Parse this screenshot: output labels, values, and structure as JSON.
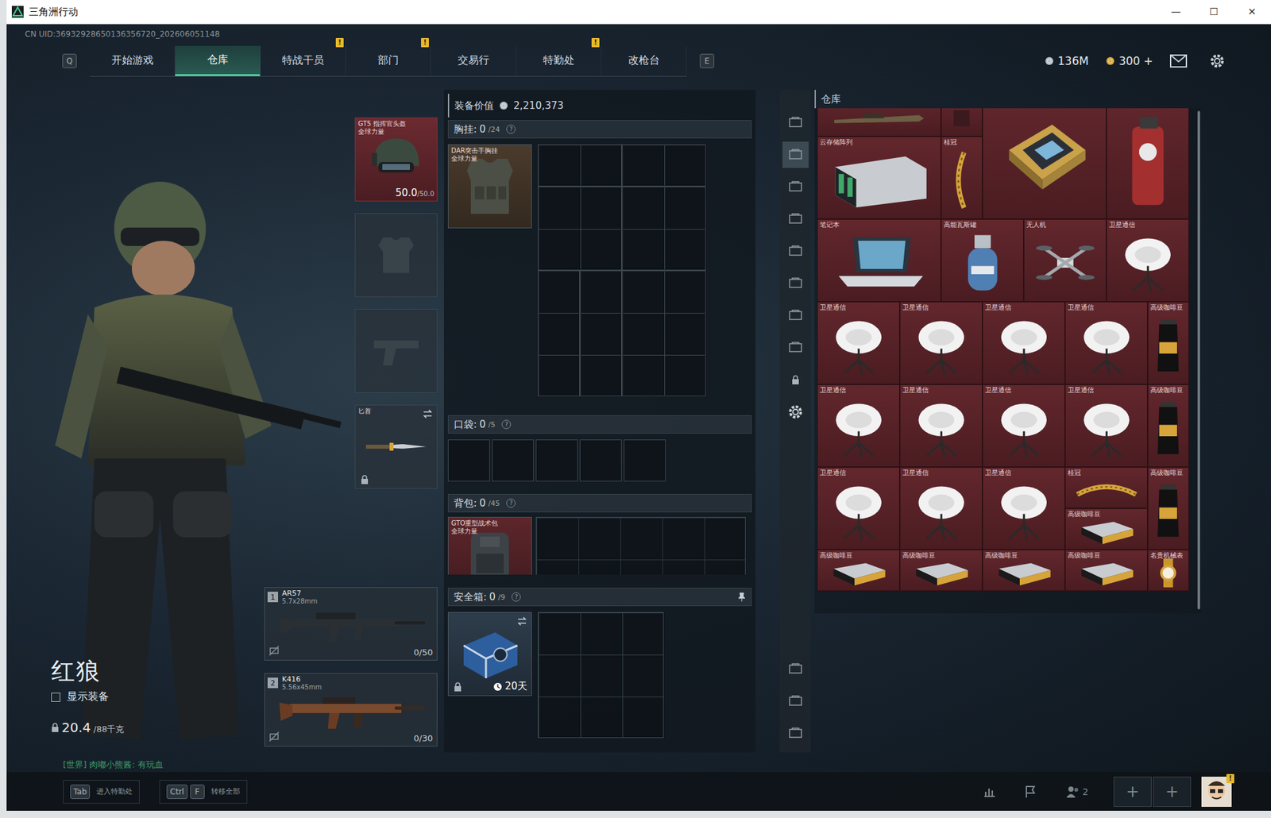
{
  "window": {
    "title": "三角洲行动",
    "buttons": [
      "—",
      "☐",
      "✕"
    ]
  },
  "uid": "CN UID:36932928650136356720_202606051148",
  "nav": {
    "left_key": "Q",
    "right_key": "E",
    "tabs": [
      {
        "label": "开始游戏",
        "selected": false,
        "alert": false,
        "badge": "!"
      },
      {
        "label": "仓库",
        "selected": true,
        "alert": false,
        "badge": "!"
      },
      {
        "label": "特战干员",
        "selected": false,
        "alert": true,
        "badge": "!"
      },
      {
        "label": "部门",
        "selected": false,
        "alert": true,
        "badge": "!"
      },
      {
        "label": "交易行",
        "selected": false,
        "alert": false,
        "badge": "!"
      },
      {
        "label": "特勤处",
        "selected": false,
        "alert": true,
        "badge": "!"
      },
      {
        "label": "改枪台",
        "selected": false,
        "alert": false,
        "badge": "!"
      }
    ]
  },
  "currency": [
    {
      "value": "136M",
      "color": "#b8c0c6"
    },
    {
      "value": "300 +",
      "color": "#d9a93a"
    }
  ],
  "operator": {
    "name": "红狼",
    "show_equipment": {
      "label": "显示装备",
      "checked": false
    },
    "weight": "20.4",
    "weight_max": "/88千克"
  },
  "chat": "[世界] 肉嘟小熊酱: 有玩血",
  "slots": {
    "helmet": {
      "name": "GT5 指挥官头盔",
      "sub": "全球力量",
      "durability": "50.0",
      "durability_max": "/50.0",
      "filled": true
    },
    "armor": {
      "filled": false
    },
    "pistol": {
      "filled": false
    },
    "melee": {
      "label": "匕首",
      "locked": true
    }
  },
  "weapons": [
    {
      "index": "1",
      "name": "AR57",
      "caliber": "5.7x28mm",
      "ammo": "0/50"
    },
    {
      "index": "2",
      "name": "K416",
      "caliber": "5.56x45mm",
      "ammo": "0/30"
    }
  ],
  "loadout": {
    "value_label": "装备价值",
    "value": "2,210,373",
    "chest": {
      "label": "胸挂:",
      "count": "0",
      "cap": "/24",
      "help": "?",
      "item": "DAR突击手胸挂",
      "item_sub": "全球力量"
    },
    "pockets": {
      "label": "口袋:",
      "count": "0",
      "cap": "/5",
      "help": "?"
    },
    "backpack": {
      "label": "背包:",
      "count": "0",
      "cap": "/45",
      "help": "?",
      "item": "GTO重型战术包",
      "item_sub": "全球力量"
    },
    "safebox": {
      "label": "安全箱:",
      "count": "0",
      "cap": "/9",
      "help": "?",
      "timer": "20天",
      "locked": true
    }
  },
  "sidebar": [
    {
      "selected": false
    },
    {
      "selected": true
    },
    {
      "selected": false
    },
    {
      "selected": false
    },
    {
      "selected": false
    },
    {
      "selected": false
    },
    {
      "selected": false
    },
    {
      "selected": false
    }
  ],
  "warehouse": {
    "title": "仓库",
    "items": [
      {
        "kind": "rifle"
      },
      {
        "kind": "misc"
      },
      {
        "kind": "cpu"
      },
      {
        "kind": "extinguisher"
      },
      {
        "kind": "server",
        "name": "云存储阵列"
      },
      {
        "kind": "crown-v",
        "name": "桂冠"
      },
      {
        "kind": "laptop",
        "name": "笔记本"
      },
      {
        "kind": "gas",
        "name": "高能瓦斯罐"
      },
      {
        "kind": "drone",
        "name": "无人机"
      },
      {
        "kind": "sat",
        "name": "卫星通信"
      },
      {
        "kind": "sat",
        "name": "卫星通信"
      },
      {
        "kind": "sat",
        "name": "卫星通信"
      },
      {
        "kind": "sat",
        "name": "卫星通信"
      },
      {
        "kind": "sat",
        "name": "卫星通信"
      },
      {
        "kind": "coffee-v",
        "name": "高级咖啡豆"
      },
      {
        "kind": "sat",
        "name": "卫星通信"
      },
      {
        "kind": "sat",
        "name": "卫星通信"
      },
      {
        "kind": "sat",
        "name": "卫星通信"
      },
      {
        "kind": "sat",
        "name": "卫星通信"
      },
      {
        "kind": "coffee-v",
        "name": "高级咖啡豆"
      },
      {
        "kind": "sat",
        "name": "卫星通信"
      },
      {
        "kind": "sat",
        "name": "卫星通信"
      },
      {
        "kind": "sat",
        "name": "卫星通信"
      },
      {
        "kind": "crown-h",
        "name": "桂冠"
      },
      {
        "kind": "coffee-v",
        "name": "高级咖啡豆"
      },
      {
        "kind": "coffee-h",
        "name": "高级咖啡豆"
      },
      {
        "kind": "coffee-h",
        "name": "高级咖啡豆"
      },
      {
        "kind": "coffee-h",
        "name": "高级咖啡豆"
      },
      {
        "kind": "coffee-h",
        "name": "高级咖啡豆"
      },
      {
        "kind": "coffee-h",
        "name": "高级咖啡豆"
      },
      {
        "kind": "watch",
        "name": "名贵机械表"
      }
    ]
  },
  "bottom": {
    "hints": [
      {
        "keys": [
          "Tab"
        ],
        "label": "进入特勤处"
      },
      {
        "keys": [
          "Ctrl",
          "F"
        ],
        "label": "转移全部"
      }
    ],
    "friends": "2",
    "slots": [
      "+",
      "+"
    ],
    "avatar_badge": "!"
  }
}
